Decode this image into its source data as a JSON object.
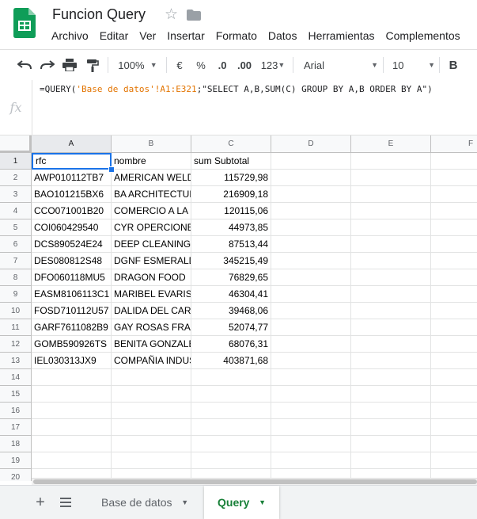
{
  "doc": {
    "title": "Funcion Query"
  },
  "menu": [
    "Archivo",
    "Editar",
    "Ver",
    "Insertar",
    "Formato",
    "Datos",
    "Herramientas",
    "Complementos"
  ],
  "toolbar": {
    "zoom": "100%",
    "currency": "€",
    "percent": "%",
    "dec_decrease": ".0",
    "dec_increase": ".00",
    "more_formats": "123",
    "font": "Arial",
    "font_size": "10",
    "bold": "B"
  },
  "formula": {
    "fx": "fx",
    "part1": "=QUERY(",
    "part2": "'Base de datos'!A1:E321",
    "part3": ";",
    "part4": "\"SELECT A,B,SUM(C) GROUP BY A,B ORDER BY A\"",
    "part5": ")"
  },
  "grid": {
    "columns": [
      "A",
      "B",
      "C",
      "D",
      "E",
      "F"
    ],
    "row_numbers": [
      "1",
      "2",
      "3",
      "4",
      "5",
      "6",
      "7",
      "8",
      "9",
      "10",
      "11",
      "12",
      "13",
      "14",
      "15",
      "16",
      "17",
      "18",
      "19",
      "20"
    ],
    "header": [
      "rfc",
      "nombre",
      "sum Subtotal"
    ],
    "rows": [
      [
        "AWP010112TB7",
        "AMERICAN WELDING",
        "115729,98"
      ],
      [
        "BAO101215BX6",
        "BA ARCHITECTURE",
        "216909,18"
      ],
      [
        "CCO071001B20",
        "COMERCIO A LA",
        "120115,06"
      ],
      [
        "COI060429540",
        "CYR OPERCIONES",
        "44973,85"
      ],
      [
        "DCS890524E24",
        "DEEP CLEANING",
        "87513,44"
      ],
      [
        "DES080812S48",
        "DGNF ESMERALDA",
        "345215,49"
      ],
      [
        "DFO060118MU5",
        "DRAGON FOOD",
        "76829,65"
      ],
      [
        "EASM8106113C1",
        "MARIBEL EVARISTO",
        "46304,41"
      ],
      [
        "FOSD710112U57",
        "DALIDA DEL CARMEN",
        "39468,06"
      ],
      [
        "GARF7611082B9",
        "GAY ROSAS FRANCISCO",
        "52074,77"
      ],
      [
        "GOMB590926TS",
        "BENITA GONZALEZ",
        "68076,31"
      ],
      [
        "IEL030313JX9",
        "COMPAÑIA INDUSTRIAL",
        "403871,68"
      ]
    ]
  },
  "sheets": {
    "tabs": [
      "Base de datos",
      "Query"
    ],
    "active": "Query"
  }
}
